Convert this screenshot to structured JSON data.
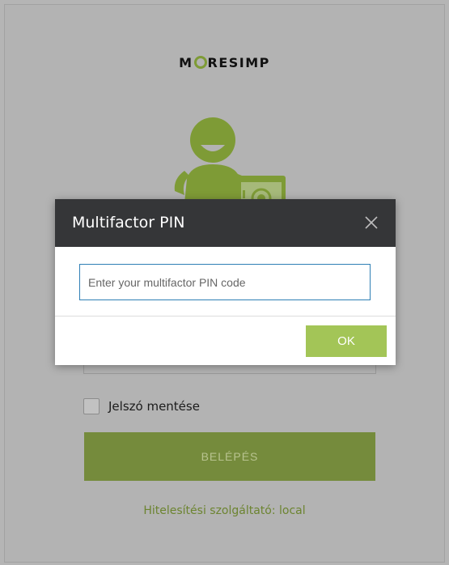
{
  "brand": {
    "logo_text_before": "M",
    "logo_text_after": "RESIMP",
    "accent_color": "#7e9b36"
  },
  "login": {
    "remember_label": "Jelszó mentése",
    "login_button": "BELÉPÉS",
    "provider_text": "Hitelesítési szolgáltató: local"
  },
  "modal": {
    "title": "Multifactor PIN",
    "pin_placeholder": "Enter your multifactor PIN code",
    "pin_value": "",
    "ok_button": "OK",
    "close_icon": "close-icon"
  }
}
